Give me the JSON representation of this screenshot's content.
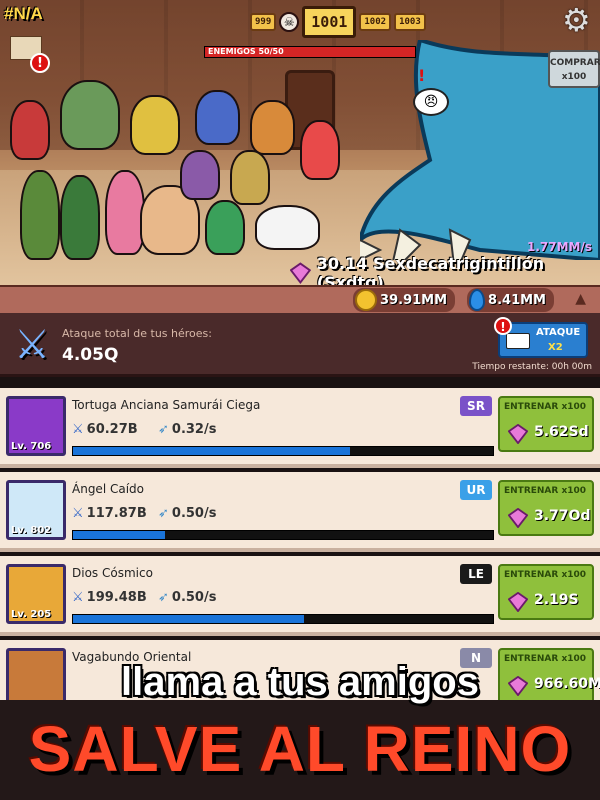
{
  "top": {
    "rank": "#N/A",
    "levels": [
      "999",
      "1001",
      "1002",
      "1003"
    ],
    "enemies_label": "ENEMIGOS 50/50",
    "enemies_progress": 1.0,
    "buy_label": "COMPRAR x100",
    "dps": "1.77MM/s",
    "gem_total": "30.14 Sexdecatrigintillón (Sxdtg)"
  },
  "currency": {
    "coins": "39.91MM",
    "drops": "8.41MM"
  },
  "attack": {
    "label": "Ataque total de tus héroes:",
    "value": "4.05Q",
    "button_line1": "ATAQUE",
    "button_line2": "X2",
    "time_left": "Tiempo restante: 00h 00m"
  },
  "heroes": [
    {
      "name": "Tortuga Anciana Samurái Ciega",
      "level": "Lv. 706",
      "rarity": "SR",
      "rarity_color": "#7a52c8",
      "attack": "60.27B",
      "speed": "0.32/s",
      "progress": 0.66,
      "train_label": "ENTRENAR x100",
      "cost": "5.62Sd"
    },
    {
      "name": "Ángel Caído",
      "level": "Lv. 802",
      "rarity": "UR",
      "rarity_color": "#3aa0e8",
      "attack": "117.87B",
      "speed": "0.50/s",
      "progress": 0.22,
      "train_label": "ENTRENAR x100",
      "cost": "3.77Od"
    },
    {
      "name": "Dios Cósmico",
      "level": "Lv. 205",
      "rarity": "LE",
      "rarity_color": "#1a1a1a",
      "attack": "199.48B",
      "speed": "0.50/s",
      "progress": 0.55,
      "train_label": "ENTRENAR x100",
      "cost": "2.19S"
    },
    {
      "name": "Vagabundo Oriental",
      "level": "",
      "rarity": "N",
      "rarity_color": "#8a8aa8",
      "attack": "",
      "speed": "",
      "progress": 0.0,
      "train_label": "ENTRENAR x100",
      "cost": "966.60M"
    }
  ],
  "promo": {
    "line1": "llama a tus amigos",
    "line2": "SALVE AL REINO"
  }
}
